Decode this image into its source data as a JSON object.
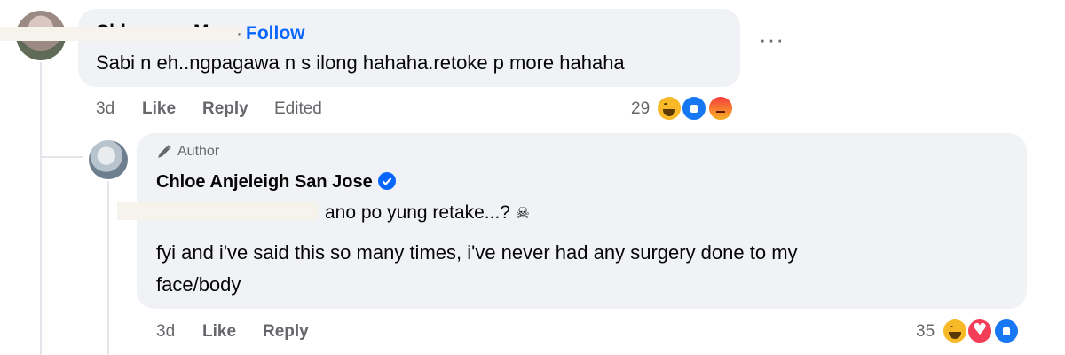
{
  "comment1": {
    "author_partial": "Chl",
    "author_partial_2": "M",
    "follow_label": "Follow",
    "text": "Sabi n eh..ngpagawa n s ilong hahaha.retoke p more hahaha",
    "time": "3d",
    "like_label": "Like",
    "reply_label": "Reply",
    "edited_label": "Edited",
    "reaction_count": "29",
    "reactions": [
      "haha",
      "like",
      "angry"
    ]
  },
  "reply1": {
    "badge_label": "Author",
    "author": "Chloe Anjeleigh San Jose",
    "text_line1": "ano po yung retake...?",
    "text_line2": "fyi and i've said this so many times, i've never had any surgery done to my",
    "text_line3": "face/body",
    "time": "3d",
    "like_label": "Like",
    "reply_label": "Reply",
    "reaction_count": "35",
    "reactions": [
      "haha",
      "love",
      "like"
    ]
  },
  "colors": {
    "accent": "#0866ff",
    "bubble": "#f0f2f5",
    "meta": "#65676b"
  }
}
